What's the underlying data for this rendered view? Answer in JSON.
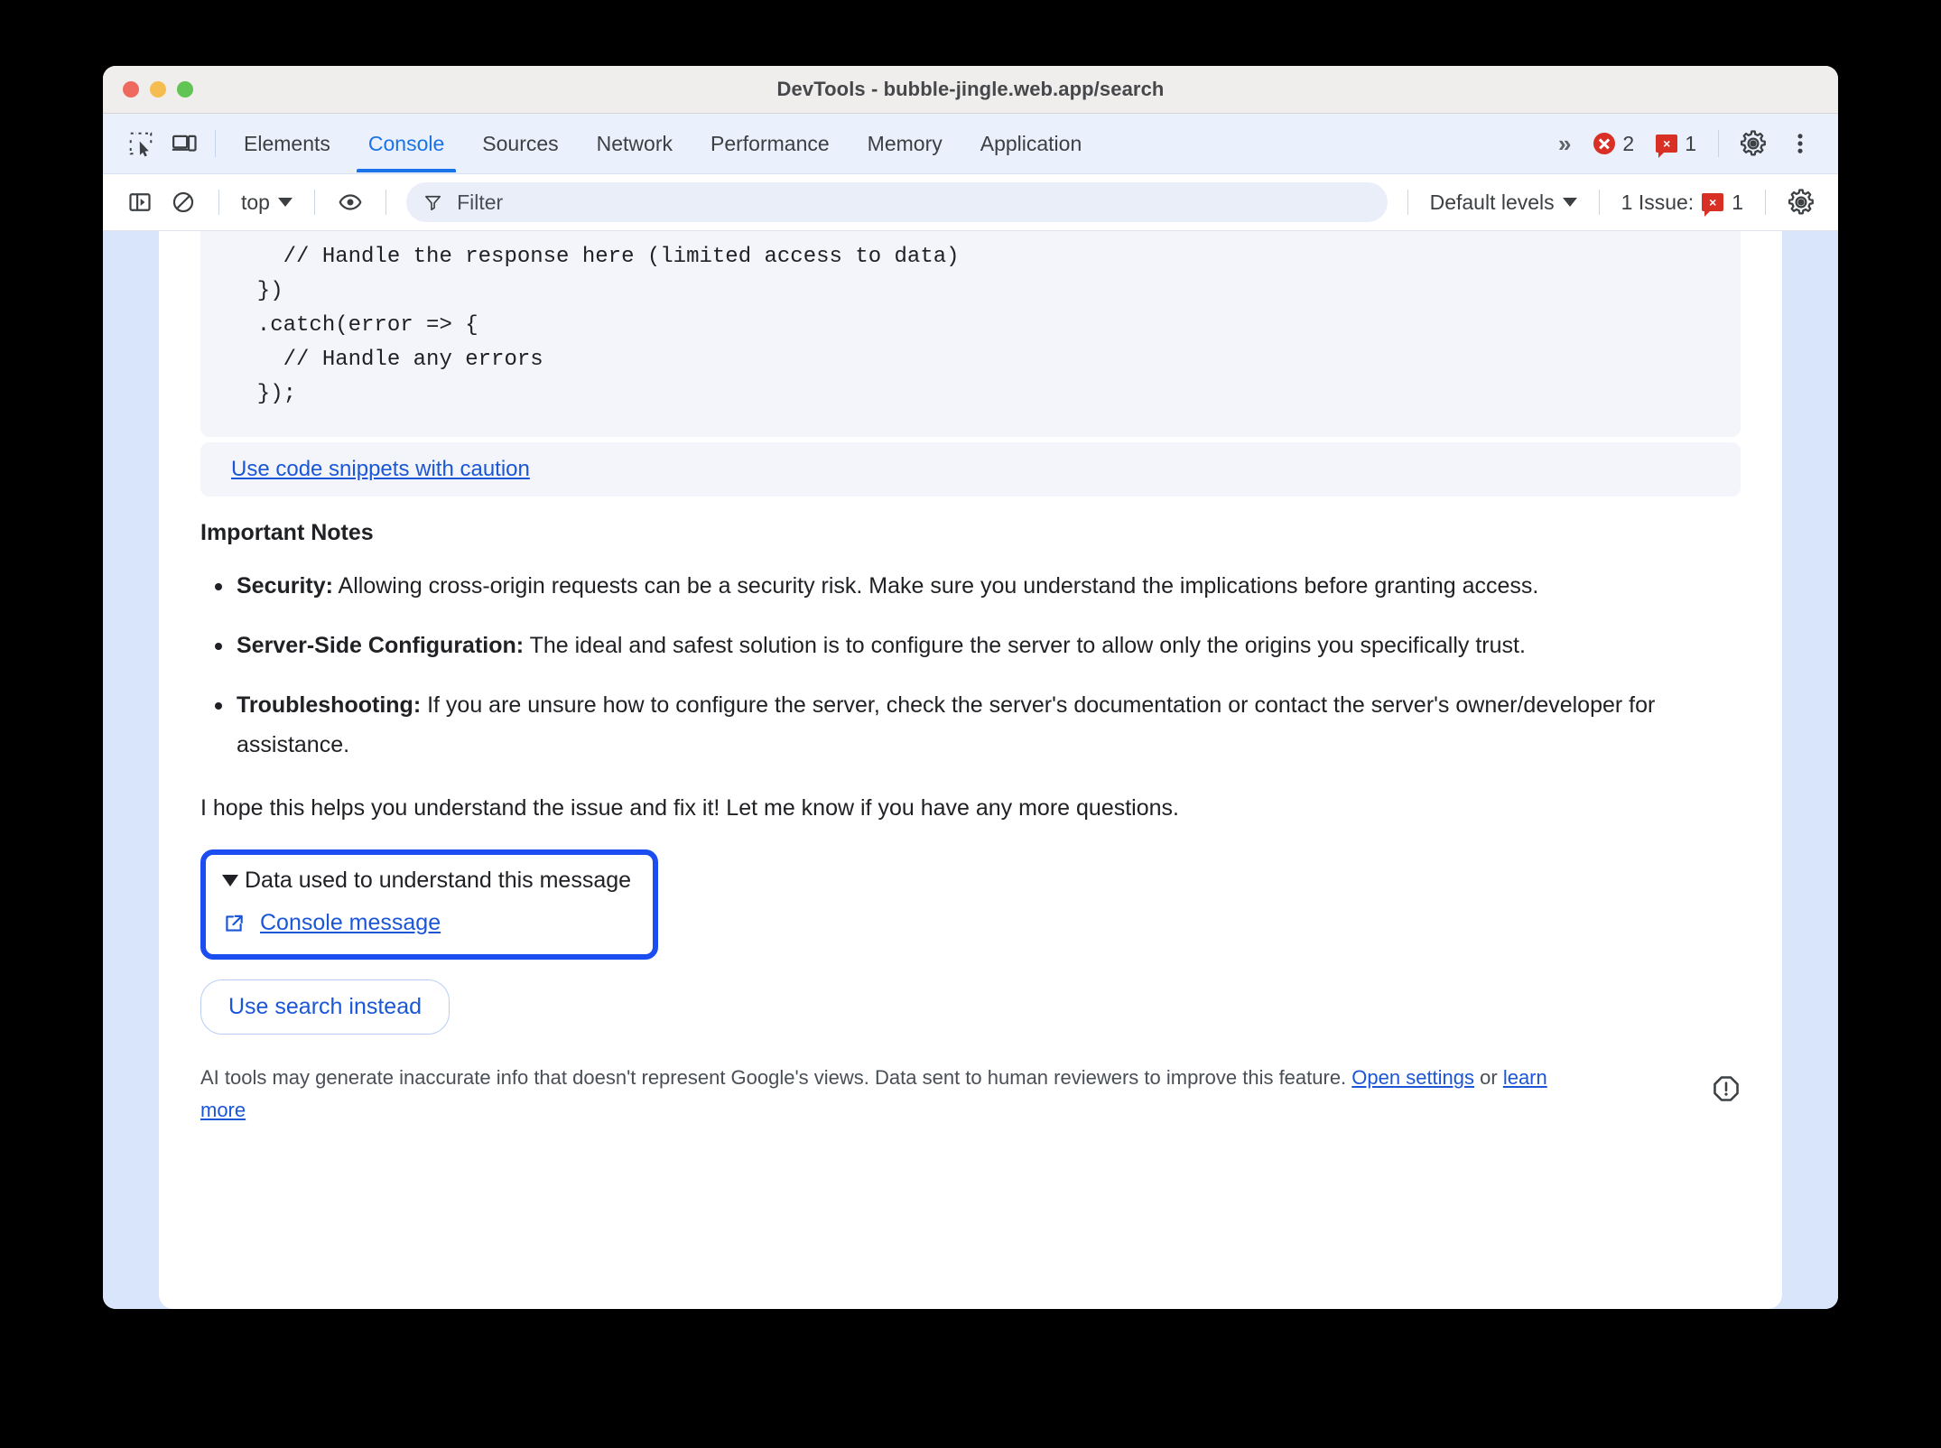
{
  "window": {
    "title": "DevTools - bubble-jingle.web.app/search",
    "traffic_lights": [
      "close",
      "minimize",
      "maximize"
    ]
  },
  "tabbar": {
    "inspect_icon": "inspect-element-icon",
    "device_icon": "device-toolbar-icon",
    "tabs": [
      {
        "label": "Elements",
        "active": false
      },
      {
        "label": "Console",
        "active": true
      },
      {
        "label": "Sources",
        "active": false
      },
      {
        "label": "Network",
        "active": false
      },
      {
        "label": "Performance",
        "active": false
      },
      {
        "label": "Memory",
        "active": false
      },
      {
        "label": "Application",
        "active": false
      }
    ],
    "more_tabs": "»",
    "error_count": "2",
    "warning_count": "1",
    "settings_icon": "gear-icon",
    "more_icon": "kebab-menu-icon",
    "accent_color": "#1a73e8",
    "error_color": "#d93025"
  },
  "console_toolbar": {
    "sidebar_toggle_icon": "sidebar-toggle-icon",
    "clear_console_icon": "clear-console-icon",
    "context_selector": "top",
    "eye_icon": "live-expression-eye-icon",
    "filter_icon": "filter-funnel-icon",
    "filter_placeholder": "Filter",
    "filter_value": "",
    "levels_selector": "Default levels",
    "issues_label": "1 Issue:",
    "issues_count": "1",
    "settings_icon": "console-settings-gear-icon"
  },
  "message": {
    "code_snippet": "    // Handle the response here (limited access to data)\n  })\n  .catch(error => {\n    // Handle any errors\n  });",
    "caution_link": "Use code snippets with caution",
    "notes_title": "Important Notes",
    "notes": [
      {
        "term": "Security:",
        "text": " Allowing cross-origin requests can be a security risk. Make sure you understand the implications before granting access."
      },
      {
        "term": "Server-Side Configuration:",
        "text": " The ideal and safest solution is to configure the server to allow only the origins you specifically trust."
      },
      {
        "term": "Troubleshooting:",
        "text": " If you are unsure how to configure the server, check the server's documentation or contact the server's owner/developer for assistance."
      }
    ],
    "closing": "I hope this helps you understand the issue and fix it! Let me know if you have any more questions.",
    "data_section": {
      "summary": "Data used to understand this message",
      "disclosure_icon": "triangle-down-icon",
      "link_icon": "external-link-icon",
      "link_label": "Console message",
      "highlight_color": "#1b4df0"
    },
    "use_search_button": "Use search instead",
    "disclaimer": {
      "part1": "AI tools may generate inaccurate info that doesn't represent Google's views. Data sent to human reviewers to improve this feature. ",
      "link1": "Open settings",
      "middle": " or ",
      "link2": "learn more",
      "warn_icon": "warning-octagon-icon"
    }
  }
}
